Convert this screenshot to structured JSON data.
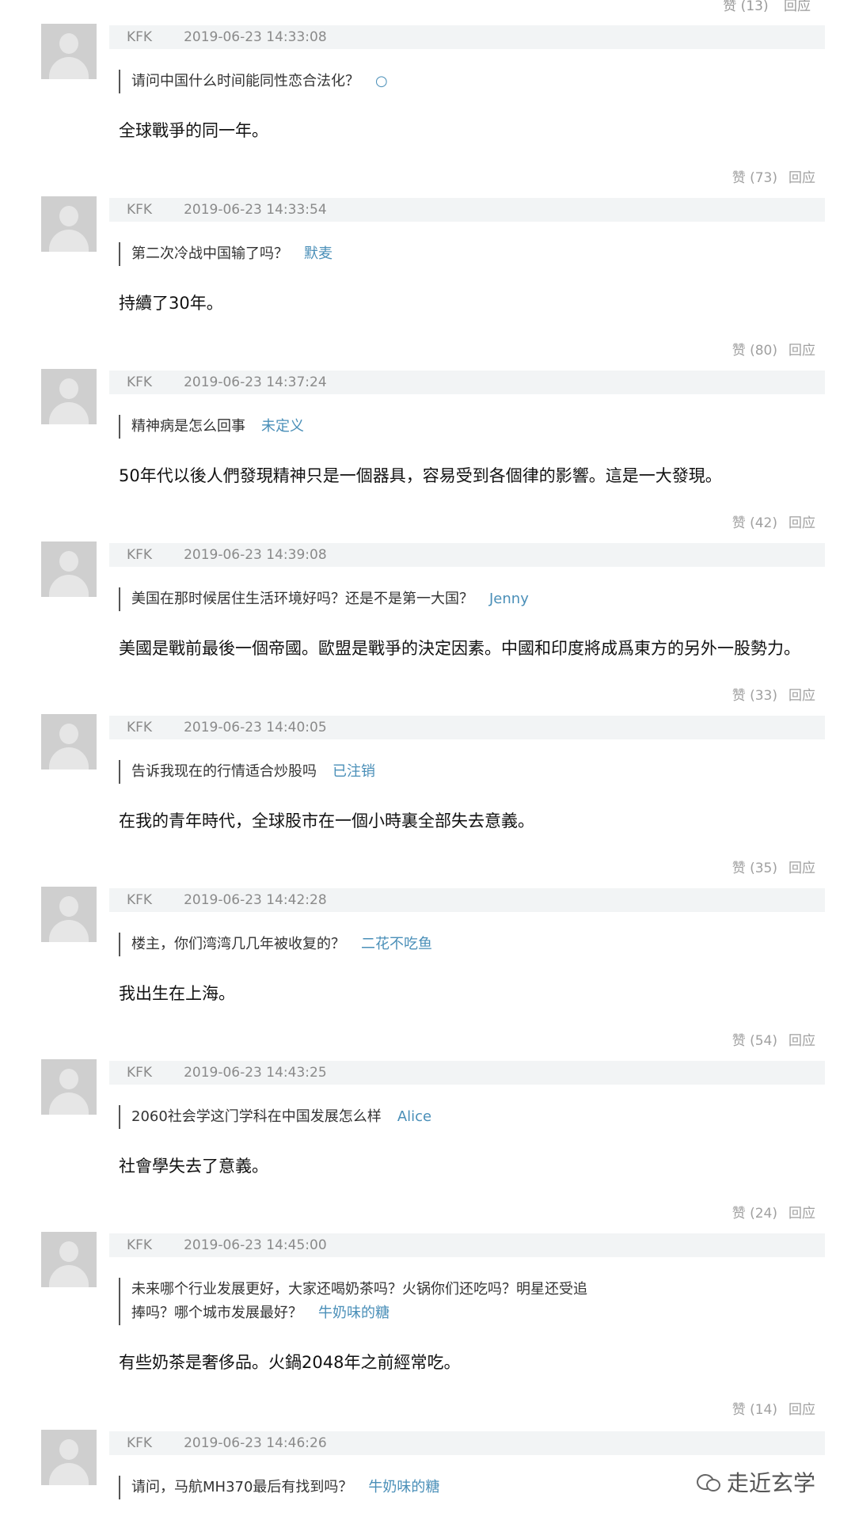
{
  "top_stats": {
    "likes": "赞 (13)",
    "reply": "回应"
  },
  "posts": [
    {
      "user": "KFK",
      "time": "2019-06-23 14:33:08",
      "question": "请问中国什么时间能同性恋合法化？",
      "asker": "○",
      "answer": "全球戰爭的同一年。",
      "likes": "赞 (73)",
      "reply": "回应"
    },
    {
      "user": "KFK",
      "time": "2019-06-23 14:33:54",
      "question": "第二次冷战中国输了吗？",
      "asker": "默麦",
      "answer": "持續了30年。",
      "likes": "赞 (80)",
      "reply": "回应"
    },
    {
      "user": "KFK",
      "time": "2019-06-23 14:37:24",
      "question": "精神病是怎么回事",
      "asker": "未定义",
      "answer": "50年代以後人們發現精神只是一個器具，容易受到各個律的影響。這是一大發現。",
      "likes": "赞 (42)",
      "reply": "回应"
    },
    {
      "user": "KFK",
      "time": "2019-06-23 14:39:08",
      "question": "美国在那时候居住生活环境好吗？还是不是第一大国？",
      "asker": "Jenny",
      "answer": "美國是戰前最後一個帝國。歐盟是戰爭的決定因素。中國和印度將成爲東方的另外一股勢力。",
      "likes": "赞 (33)",
      "reply": "回应"
    },
    {
      "user": "KFK",
      "time": "2019-06-23 14:40:05",
      "question": "告诉我现在的行情适合炒股吗",
      "asker": "已注销",
      "answer": "在我的青年時代，全球股市在一個小時裏全部失去意義。",
      "likes": "赞 (35)",
      "reply": "回应"
    },
    {
      "user": "KFK",
      "time": "2019-06-23 14:42:28",
      "question": "楼主，你们湾湾几几年被收复的？",
      "asker": "二花不吃鱼",
      "answer": "我出生在上海。",
      "likes": "赞 (54)",
      "reply": "回应"
    },
    {
      "user": "KFK",
      "time": "2019-06-23 14:43:25",
      "question": "2060社会学这门学科在中国发展怎么样",
      "asker": "Alice",
      "answer": "社會學失去了意義。",
      "likes": "赞 (24)",
      "reply": "回应"
    },
    {
      "user": "KFK",
      "time": "2019-06-23 14:45:00",
      "question": "未来哪个行业发展更好，大家还喝奶茶吗？火锅你们还吃吗？明星还受追捧吗？哪个城市发展最好？",
      "asker": "牛奶味的糖",
      "answer": "有些奶茶是奢侈品。火鍋2048年之前經常吃。",
      "likes": "赞 (14)",
      "reply": "回应"
    },
    {
      "user": "KFK",
      "time": "2019-06-23 14:46:26",
      "question": "请问，马航MH370最后有找到吗？",
      "asker": "牛奶味的糖",
      "answer": "",
      "likes": "",
      "reply": ""
    }
  ],
  "watermark": {
    "text": "走近玄学",
    "icon": "wechat-icon"
  }
}
